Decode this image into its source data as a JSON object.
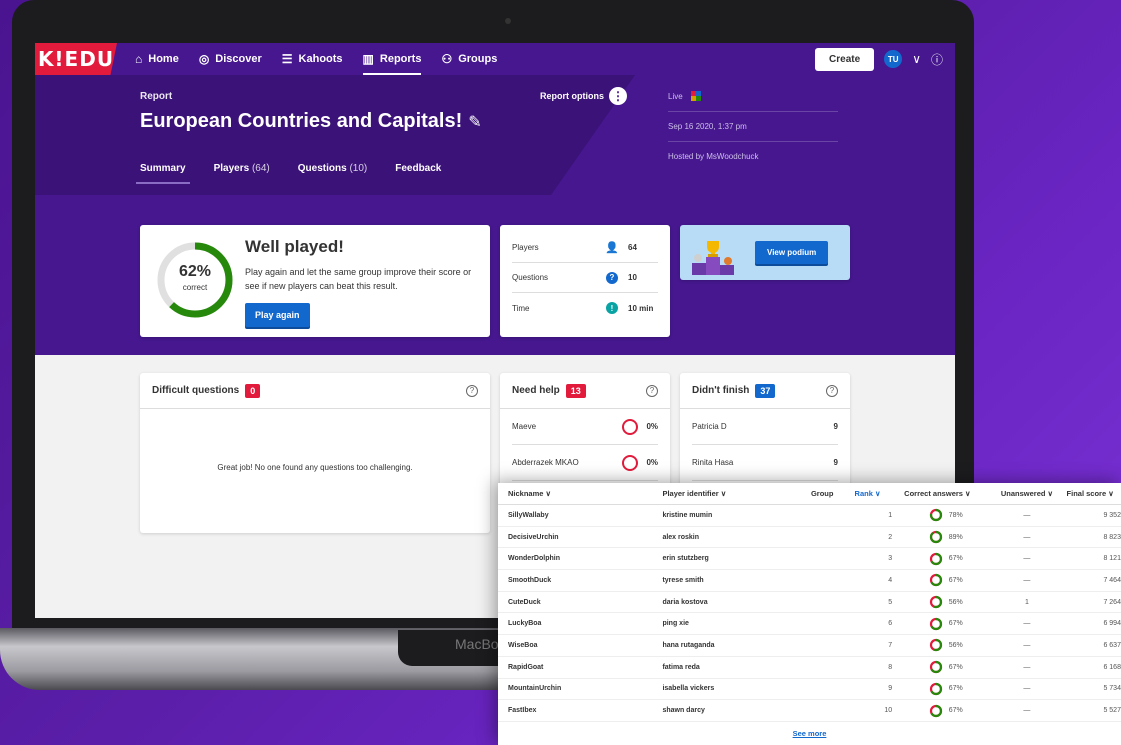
{
  "device": {
    "brand_text": "MacBo"
  },
  "nav": {
    "logo": "K!EDU",
    "items": [
      {
        "label": "Home",
        "icon": "⌂"
      },
      {
        "label": "Discover",
        "icon": "◎"
      },
      {
        "label": "Kahoots",
        "icon": "☰"
      },
      {
        "label": "Reports",
        "icon": "▥"
      },
      {
        "label": "Groups",
        "icon": "⚇"
      }
    ],
    "create_label": "Create",
    "avatar_initials": "TU",
    "chevron": "∨",
    "info": "ⓘ"
  },
  "header": {
    "report_label": "Report",
    "title": "European Countries and Capitals!",
    "report_options": "Report options",
    "live_label": "Live",
    "date": "Sep 16 2020, 1:37 pm",
    "hosted_by": "Hosted by MsWoodchuck",
    "tabs": [
      {
        "label": "Summary",
        "count": ""
      },
      {
        "label": "Players",
        "count": "(64)"
      },
      {
        "label": "Questions",
        "count": "(10)"
      },
      {
        "label": "Feedback",
        "count": ""
      }
    ]
  },
  "summary": {
    "percent": "62%",
    "percent_value": 62,
    "percent_sub": "correct",
    "title": "Well played!",
    "text": "Play again and let the same group improve their score or see if new players can beat this result.",
    "play_again": "Play again",
    "stats": [
      {
        "label": "Players",
        "value": "64",
        "icon": "person-icon",
        "color": "#864cbf"
      },
      {
        "label": "Questions",
        "value": "10",
        "icon": "question-icon",
        "color": "#1368ce"
      },
      {
        "label": "Time",
        "value": "10 min",
        "icon": "clock-icon",
        "color": "#26890c"
      }
    ],
    "view_podium": "View podium"
  },
  "difficult": {
    "title": "Difficult questions",
    "count": "0",
    "empty_text": "Great job! No one found any questions too challenging."
  },
  "need_help": {
    "title": "Need help",
    "count": "13",
    "rows": [
      {
        "name": "Maeve",
        "value": "0%"
      },
      {
        "name": "Abderrazek MKAO",
        "value": "0%"
      }
    ]
  },
  "didnt_finish": {
    "title": "Didn't finish",
    "count": "37",
    "rows": [
      {
        "name": "Patricia D",
        "value": "9"
      },
      {
        "name": "Rinita Hasa",
        "value": "9"
      }
    ]
  },
  "players_table": {
    "headers": {
      "nickname": "Nickname ∨",
      "player_id": "Player identifier ∨",
      "group": "Group",
      "rank": "Rank ∨",
      "correct": "Correct answers ∨",
      "unanswered": "Unanswered ∨",
      "final": "Final score ∨"
    },
    "rows": [
      {
        "nickname": "SillyWallaby",
        "pid": "kristine mumin",
        "rank": "1",
        "correct": "78%",
        "correct_value": 78,
        "unanswered": "—",
        "final": "9 352"
      },
      {
        "nickname": "DecisiveUrchin",
        "pid": "alex roskin",
        "rank": "2",
        "correct": "89%",
        "correct_value": 89,
        "unanswered": "—",
        "final": "8 823"
      },
      {
        "nickname": "WonderDolphin",
        "pid": "erin stutzberg",
        "rank": "3",
        "correct": "67%",
        "correct_value": 67,
        "unanswered": "—",
        "final": "8 121"
      },
      {
        "nickname": "SmoothDuck",
        "pid": "tyrese smith",
        "rank": "4",
        "correct": "67%",
        "correct_value": 67,
        "unanswered": "—",
        "final": "7 464"
      },
      {
        "nickname": "CuteDuck",
        "pid": "daria kostova",
        "rank": "5",
        "correct": "56%",
        "correct_value": 56,
        "unanswered": "1",
        "final": "7 264"
      },
      {
        "nickname": "LuckyBoa",
        "pid": "ping xie",
        "rank": "6",
        "correct": "67%",
        "correct_value": 67,
        "unanswered": "—",
        "final": "6 994"
      },
      {
        "nickname": "WiseBoa",
        "pid": "hana rutaganda",
        "rank": "7",
        "correct": "56%",
        "correct_value": 56,
        "unanswered": "—",
        "final": "6 637"
      },
      {
        "nickname": "RapidGoat",
        "pid": "fatima reda",
        "rank": "8",
        "correct": "67%",
        "correct_value": 67,
        "unanswered": "—",
        "final": "6 168"
      },
      {
        "nickname": "MountainUrchin",
        "pid": "isabella vickers",
        "rank": "9",
        "correct": "67%",
        "correct_value": 67,
        "unanswered": "—",
        "final": "5 734"
      },
      {
        "nickname": "FastIbex",
        "pid": "shawn darcy",
        "rank": "10",
        "correct": "67%",
        "correct_value": 67,
        "unanswered": "—",
        "final": "5 527"
      }
    ],
    "see_more": "See more"
  },
  "colors": {
    "brand_purple": "#46178f",
    "brand_red": "#e21b3c",
    "brand_blue": "#1368ce",
    "success_green": "#26890c"
  }
}
